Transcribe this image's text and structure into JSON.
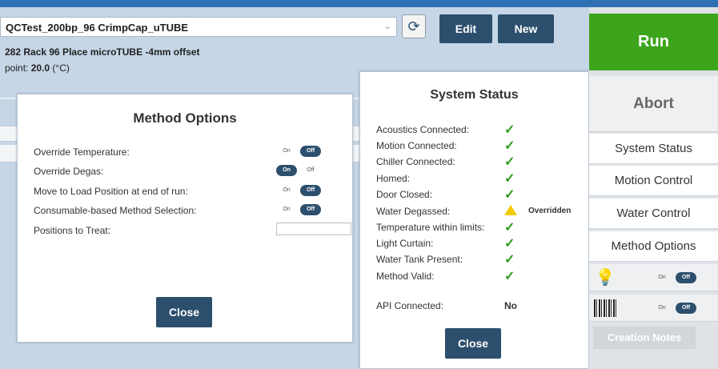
{
  "header": {
    "method_name": "QCTest_200bp_96 CrimpCap_uTUBE",
    "edit_label": "Edit",
    "new_label": "New",
    "plate_description": "282 Rack 96 Place microTUBE -4mm offset",
    "setpoint_prefix": "point:",
    "setpoint_value": "20.0",
    "setpoint_unit": "(°C)"
  },
  "method_options": {
    "title": "Method Options",
    "rows": [
      {
        "label": "Override Temperature:",
        "on": "On",
        "off": "Off",
        "state": "off"
      },
      {
        "label": "Override Degas:",
        "on": "On",
        "off": "Off",
        "state": "on"
      },
      {
        "label": "Move to Load Position at end of run:",
        "on": "On",
        "off": "Off",
        "state": "off"
      },
      {
        "label": "Consumable-based Method Selection:",
        "on": "On",
        "off": "Off",
        "state": "off"
      }
    ],
    "positions_label": "Positions to Treat:",
    "positions_value": "",
    "close_label": "Close"
  },
  "system_status": {
    "title": "System Status",
    "rows": [
      {
        "label": "Acoustics Connected:",
        "status": "ok"
      },
      {
        "label": "Motion Connected:",
        "status": "ok"
      },
      {
        "label": "Chiller Connected:",
        "status": "ok"
      },
      {
        "label": "Homed:",
        "status": "ok"
      },
      {
        "label": "Door Closed:",
        "status": "ok"
      },
      {
        "label": "Water Degassed:",
        "status": "warning",
        "note": "Overridden"
      },
      {
        "label": "Temperature within limits:",
        "status": "ok"
      },
      {
        "label": "Light Curtain:",
        "status": "ok"
      },
      {
        "label": "Water Tank Present:",
        "status": "ok"
      },
      {
        "label": "Method Valid:",
        "status": "ok"
      }
    ],
    "api_label": "API Connected:",
    "api_value": "No",
    "close_label": "Close",
    "check_glyph": "✓"
  },
  "sidebar": {
    "run_label": "Run",
    "abort_label": "Abort",
    "items": [
      "System Status",
      "Motion Control",
      "Water Control",
      "Method Options"
    ],
    "light_toggle": {
      "on": "On",
      "off": "Off",
      "state": "off"
    },
    "barcode_toggle": {
      "on": "On",
      "off": "Off",
      "state": "off"
    },
    "creation_notes_label": "Creation Notes"
  },
  "colors": {
    "accent": "#2c4f6d",
    "run_green": "#3da51c",
    "ok_green": "#2f9a1d",
    "warning_yellow": "#f2cc00"
  }
}
